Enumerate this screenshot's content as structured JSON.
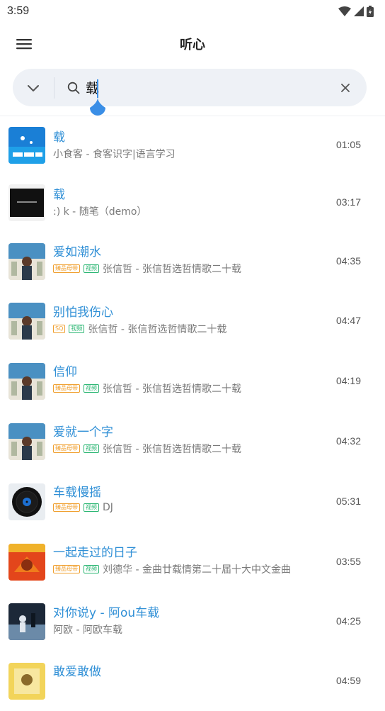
{
  "status": {
    "time": "3:59"
  },
  "header": {
    "title": "听心"
  },
  "search": {
    "value": "载"
  },
  "songs": [
    {
      "title": "载",
      "artist": "小食客 - 食客识字|语言学习",
      "tags": [],
      "duration": "01:05",
      "cover": "blue-sky"
    },
    {
      "title": "载",
      "artist": ":) k - 随笔（demo）",
      "tags": [],
      "duration": "03:17",
      "cover": "dark"
    },
    {
      "title": "爱如潮水",
      "artist": "张信哲 - 张信哲选哲情歌二十载",
      "tags": [
        "臻品母带",
        "视频"
      ],
      "duration": "04:35",
      "cover": "photo"
    },
    {
      "title": "别怕我伤心",
      "artist": "张信哲 - 张信哲选哲情歌二十载",
      "tags": [
        "SQ",
        "视频"
      ],
      "duration": "04:47",
      "cover": "photo"
    },
    {
      "title": "信仰",
      "artist": "张信哲 - 张信哲选哲情歌二十载",
      "tags": [
        "臻品母带",
        "视频"
      ],
      "duration": "04:19",
      "cover": "photo"
    },
    {
      "title": "爱就一个字",
      "artist": "张信哲 - 张信哲选哲情歌二十载",
      "tags": [
        "臻品母带",
        "视频"
      ],
      "duration": "04:32",
      "cover": "photo"
    },
    {
      "title": "车载慢摇",
      "artist": "DJ",
      "tags": [
        "臻品母带",
        "视频"
      ],
      "duration": "05:31",
      "cover": "vinyl"
    },
    {
      "title": "一起走过的日子",
      "artist": "刘德华 - 金曲廿载情第二十届十大中文金曲",
      "tags": [
        "臻品母带",
        "视频"
      ],
      "duration": "03:55",
      "cover": "orange"
    },
    {
      "title": "对你说y - 阿ou车载",
      "artist": "阿欧 - 阿欧车载",
      "tags": [],
      "duration": "04:25",
      "cover": "night"
    },
    {
      "title": "敢爱敢做",
      "artist": "",
      "tags": [],
      "duration": "04:59",
      "cover": "yellow"
    }
  ],
  "colors": {
    "accent": "#2f8fd6",
    "search_bg": "#eef1f6",
    "tag_orange": "#f0a030",
    "tag_green": "#2bb673"
  }
}
